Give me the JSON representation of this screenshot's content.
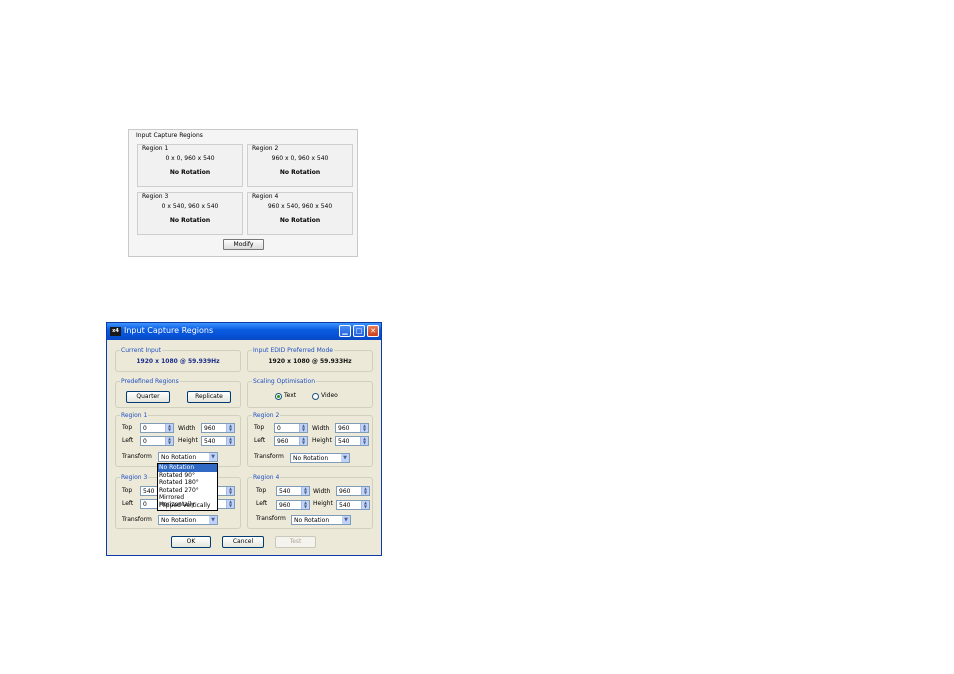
{
  "summary": {
    "title": "Input Capture Regions",
    "regions": [
      {
        "label": "Region 1",
        "coords": "0 x 0, 960 x 540",
        "rotation": "No Rotation"
      },
      {
        "label": "Region 2",
        "coords": "960 x 0, 960 x 540",
        "rotation": "No Rotation"
      },
      {
        "label": "Region 3",
        "coords": "0 x 540, 960 x 540",
        "rotation": "No Rotation"
      },
      {
        "label": "Region 4",
        "coords": "960 x 540, 960 x 540",
        "rotation": "No Rotation"
      }
    ],
    "modify_label": "Modify"
  },
  "dialog": {
    "title": "Input Capture Regions",
    "app_icon": "x4",
    "current_input": {
      "label": "Current Input",
      "value": "1920 x 1080 @ 59.939Hz"
    },
    "edid": {
      "label": "Input EDID Preferred Mode",
      "value": "1920 x 1080 @ 59.933Hz"
    },
    "predefined": {
      "label": "Predefined Regions",
      "quarter": "Quarter",
      "replicate": "Replicate"
    },
    "scaling": {
      "label": "Scaling Optimisation",
      "text": "Text",
      "video": "Video",
      "selected": "Text"
    },
    "field_labels": {
      "top": "Top",
      "left": "Left",
      "width": "Width",
      "height": "Height",
      "transform": "Transform"
    },
    "regions": [
      {
        "label": "Region 1",
        "top": "0",
        "left": "0",
        "width": "960",
        "height": "540",
        "transform": "No Rotation"
      },
      {
        "label": "Region 2",
        "top": "0",
        "left": "960",
        "width": "960",
        "height": "540",
        "transform": "No Rotation"
      },
      {
        "label": "Region 3",
        "top": "540",
        "left": "0",
        "width": "960",
        "height": "540",
        "transform": "No Rotation"
      },
      {
        "label": "Region 4",
        "top": "540",
        "left": "960",
        "width": "960",
        "height": "540",
        "transform": "No Rotation"
      }
    ],
    "transform_options": [
      "No Rotation",
      "Rotated 90°",
      "Rotated 180°",
      "Rotated 270°",
      "Mirrored Horizontally",
      "Flipped Vertically"
    ],
    "buttons": {
      "ok": "OK",
      "cancel": "Cancel",
      "test": "Test"
    }
  }
}
